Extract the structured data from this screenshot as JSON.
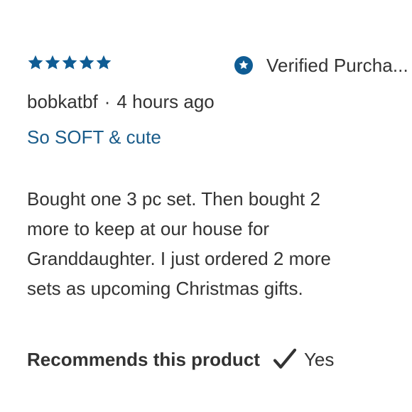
{
  "review": {
    "rating": 5,
    "rating_max": 5,
    "verified_label": "Verified Purcha...",
    "author": "bobkatbf",
    "separator": "·",
    "time_ago": "4 hours ago",
    "headline": "So SOFT & cute",
    "body_lines": [
      "Bought one 3 pc set. Then bought 2",
      "more to keep at our house for",
      "Granddaughter. I just ordered 2 more",
      "sets as upcoming Christmas gifts."
    ],
    "recommend_label": "Recommends this product",
    "recommend_value": "Yes"
  },
  "icons": {
    "star": "star-icon",
    "verified": "verified-badge-icon",
    "check": "checkmark-icon"
  },
  "colors": {
    "star": "#0f5c94",
    "verified_badge": "#0f5c94",
    "headline": "#1a5c8a",
    "text": "#333333",
    "check": "#333333"
  }
}
